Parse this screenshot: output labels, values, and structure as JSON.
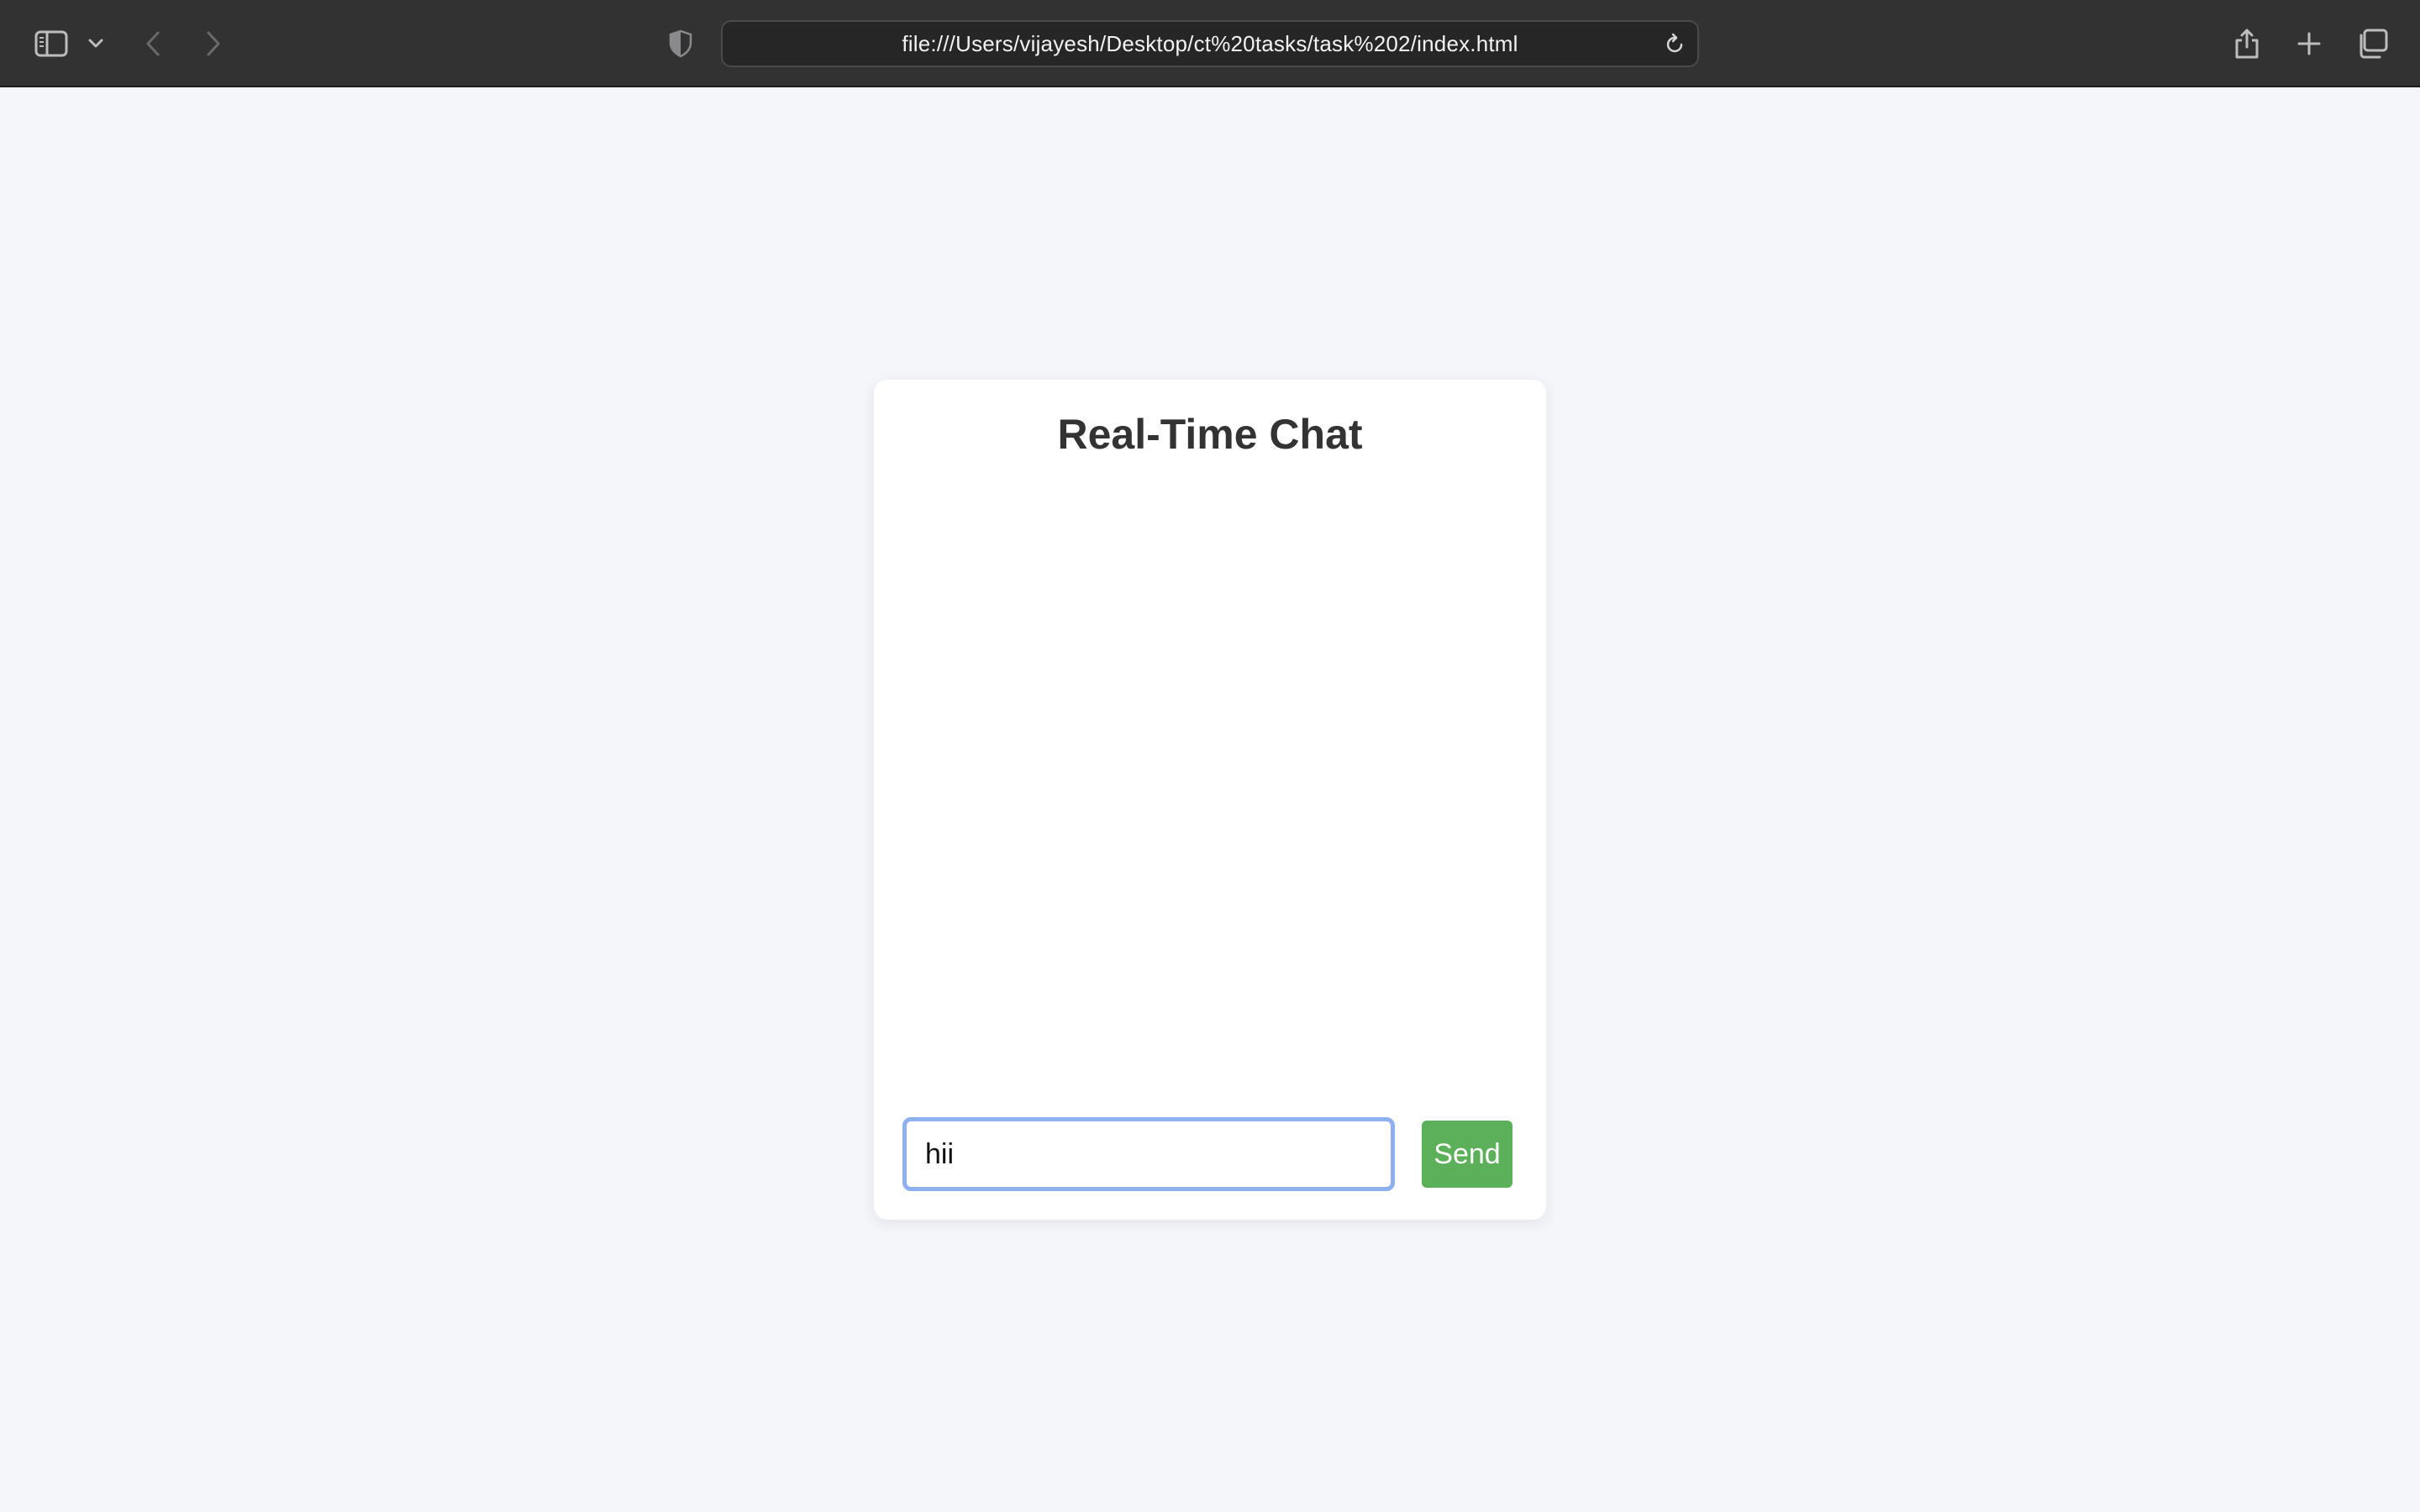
{
  "browser": {
    "url": "file:///Users/vijayesh/Desktop/ct%20tasks/task%202/index.html",
    "icons": {
      "sidebar": "sidebar-icon",
      "sidebar_menu": "chevron-down-icon",
      "back": "chevron-left-icon",
      "forward": "chevron-right-icon",
      "privacy": "shield-icon",
      "reload": "reload-icon",
      "share": "share-icon",
      "new_tab": "plus-icon",
      "tabs": "tab-overview-icon"
    }
  },
  "chat": {
    "title": "Real-Time Chat",
    "input_value": "hii",
    "send_label": "Send",
    "messages": []
  },
  "colors": {
    "toolbar_bg": "#323233",
    "page_bg": "#f4f6fa",
    "card_bg": "#ffffff",
    "send_button": "#5cb05a",
    "input_focus_border": "#8fb0ef",
    "title_text": "#333333"
  }
}
